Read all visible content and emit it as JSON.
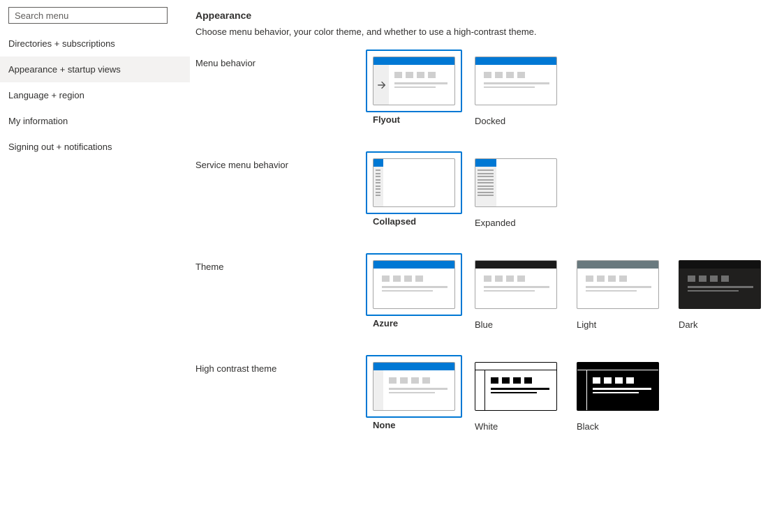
{
  "sidebar": {
    "search_placeholder": "Search menu",
    "items": [
      {
        "label": "Directories + subscriptions",
        "active": false
      },
      {
        "label": "Appearance + startup views",
        "active": true
      },
      {
        "label": "Language + region",
        "active": false
      },
      {
        "label": "My information",
        "active": false
      },
      {
        "label": "Signing out + notifications",
        "active": false
      }
    ]
  },
  "page": {
    "title": "Appearance",
    "subtitle": "Choose menu behavior, your color theme, and whether to use a high-contrast theme."
  },
  "sections": {
    "menu_behavior": {
      "label": "Menu behavior",
      "options": [
        {
          "label": "Flyout",
          "selected": true
        },
        {
          "label": "Docked",
          "selected": false
        }
      ]
    },
    "service_menu_behavior": {
      "label": "Service menu behavior",
      "options": [
        {
          "label": "Collapsed",
          "selected": true
        },
        {
          "label": "Expanded",
          "selected": false
        }
      ]
    },
    "theme": {
      "label": "Theme",
      "options": [
        {
          "label": "Azure",
          "selected": true
        },
        {
          "label": "Blue",
          "selected": false
        },
        {
          "label": "Light",
          "selected": false
        },
        {
          "label": "Dark",
          "selected": false
        }
      ]
    },
    "high_contrast": {
      "label": "High contrast theme",
      "options": [
        {
          "label": "None",
          "selected": true
        },
        {
          "label": "White",
          "selected": false
        },
        {
          "label": "Black",
          "selected": false
        }
      ]
    }
  }
}
